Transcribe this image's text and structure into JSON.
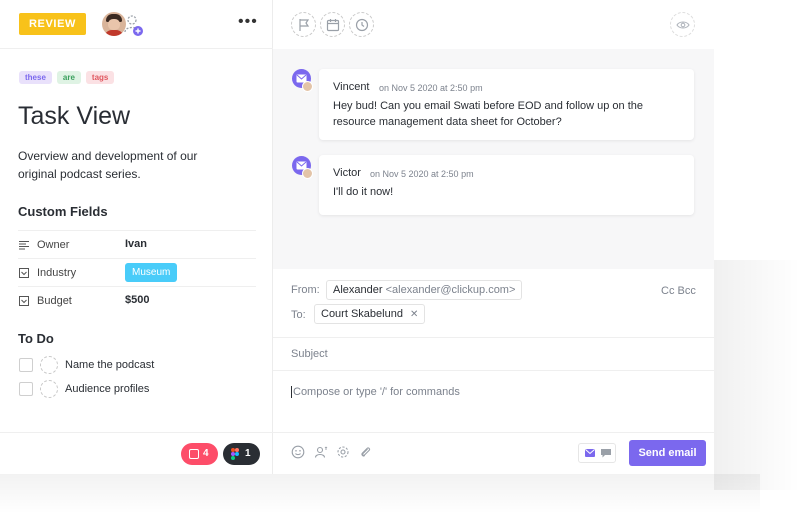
{
  "task": {
    "status": "REVIEW",
    "more_label": "•••",
    "tags": [
      "these",
      "are",
      "tags"
    ],
    "title": "Task View",
    "description": "Overview and development of our original podcast series."
  },
  "custom_fields": {
    "title": "Custom Fields",
    "rows": [
      {
        "label": "Owner",
        "value": "Ivan",
        "icon": "text-field-icon"
      },
      {
        "label": "Industry",
        "value": "Museum",
        "icon": "dropdown-field-icon"
      },
      {
        "label": "Budget",
        "value": "$500",
        "icon": "dropdown-field-icon"
      }
    ]
  },
  "todo": {
    "title": "To Do",
    "items": [
      "Name the podcast",
      "Audience profiles"
    ]
  },
  "footer_badges": [
    {
      "count": "4",
      "color": "#fd4d69",
      "icon": "calendar-icon"
    },
    {
      "count": "1",
      "color": "#2a2e34",
      "icon": "figma-icon"
    }
  ],
  "toolbar_icons": [
    "flag-icon",
    "calendar-icon",
    "clock-icon",
    "eye-icon"
  ],
  "messages": [
    {
      "author": "Vincent",
      "time": "on Nov 5 2020 at 2:50 pm",
      "text": "Hey bud! Can you email Swati before EOD and follow up on the resource management data sheet for October?"
    },
    {
      "author": "Victor",
      "time": "on Nov 5 2020 at 2:50 pm",
      "text": "I'll do it now!"
    }
  ],
  "composer": {
    "from_label": "From:",
    "from_name": "Alexander",
    "from_email": "<alexander@clickup.com>",
    "cc_bcc": "Cc Bcc",
    "to_label": "To:",
    "to_name": "Court Skabelund",
    "to_remove": "✕",
    "subject_placeholder": "Subject",
    "body_placeholder": "Compose or type '/' for commands",
    "send_label": "Send email"
  },
  "colors": {
    "accent": "#7b68ee",
    "status": "#f8c21a",
    "industry_pill": "#49ccf9"
  }
}
